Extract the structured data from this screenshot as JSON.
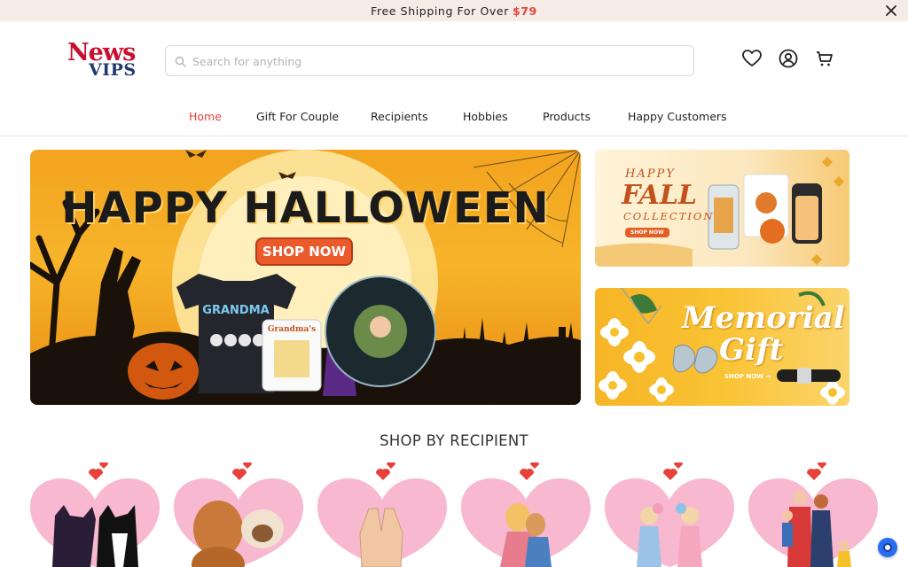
{
  "announcement": {
    "text": "Free Shipping For Over",
    "amount": "$79"
  },
  "logo": {
    "line1": "News",
    "line2": "VIPS"
  },
  "search": {
    "placeholder": "Search for anything"
  },
  "header_icons": [
    "heart-icon",
    "user-icon",
    "cart-icon"
  ],
  "nav": [
    {
      "label": "Home",
      "active": true
    },
    {
      "label": "Gift For Couple",
      "active": false
    },
    {
      "label": "Recipients",
      "active": false
    },
    {
      "label": "Hobbies",
      "active": false
    },
    {
      "label": "Products",
      "active": false
    },
    {
      "label": "Happy Customers",
      "active": false
    }
  ],
  "hero": {
    "title": "HAPPY HALLOWEEN",
    "button": "SHOP NOW"
  },
  "promos": {
    "fall": {
      "line1": "HAPPY",
      "line2": "FALL",
      "line3": "COLLECTION",
      "button": "SHOP NOW"
    },
    "memorial": {
      "line1": "Memorial",
      "line2": "Gift",
      "button": "SHOP NOW →"
    }
  },
  "section": {
    "title": "SHOP BY RECIPIENT"
  },
  "recipient_cards": [
    "cat-parents",
    "dog-parents",
    "memorial",
    "couple",
    "besties",
    "family"
  ],
  "colors": {
    "accent": "#e8413a",
    "announce_bg": "#f6ece6",
    "heart_pink": "#f6a9c4"
  }
}
